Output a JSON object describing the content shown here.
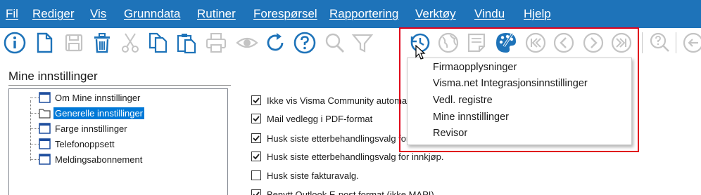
{
  "menubar": {
    "items": [
      {
        "label": "Fil"
      },
      {
        "label": "Rediger"
      },
      {
        "label": "Vis"
      },
      {
        "label": "Grunndata"
      },
      {
        "label": "Rutiner"
      },
      {
        "label": "Forespørsel"
      },
      {
        "label": "Rapportering"
      },
      {
        "label": "Verktøy"
      },
      {
        "label": "Vindu"
      },
      {
        "label": "Hjelp"
      }
    ],
    "color": "#1e73b9"
  },
  "toolbar": {
    "icons": [
      "info-icon",
      "new-document-icon",
      "save-icon",
      "delete-icon",
      "cut-icon",
      "copy-icon",
      "paste-icon",
      "print-icon",
      "preview-icon",
      "refresh-icon",
      "help-icon",
      "search-icon",
      "filter-icon",
      "history-icon",
      "globe-icon",
      "note-icon",
      "palette-icon",
      "first-record-icon",
      "previous-record-icon",
      "next-record-icon",
      "last-record-icon",
      "context-help-icon",
      "back-icon"
    ],
    "accent_color": "#1e73b9"
  },
  "panel": {
    "title": "Mine innstillinger",
    "tree": [
      {
        "label": "Om Mine innstillinger",
        "icon": "page-icon",
        "selected": false
      },
      {
        "label": "Generelle innstillinger",
        "icon": "folder-icon",
        "selected": true
      },
      {
        "label": "Farge innstillinger",
        "icon": "page-icon",
        "selected": false
      },
      {
        "label": "Telefonoppsett",
        "icon": "page-icon",
        "selected": false
      },
      {
        "label": "Meldingsabonnement",
        "icon": "page-icon",
        "selected": false
      }
    ]
  },
  "settings": {
    "checkboxes": [
      {
        "label": "Ikke vis Visma Community automat",
        "checked": true
      },
      {
        "label": "Mail vedlegg i PDF-format",
        "checked": true
      },
      {
        "label": "Husk siste etterbehandlingsvalg for",
        "checked": true
      },
      {
        "label": "Husk siste etterbehandlingsvalg for innkjøp.",
        "checked": true
      },
      {
        "label": "Husk siste fakturavalg.",
        "checked": false
      },
      {
        "label": "Benytt Outlook E-post format (ikke MAPI)",
        "checked": true
      }
    ]
  },
  "dropdown": {
    "items": [
      {
        "label": "Firmaopplysninger"
      },
      {
        "label": "Visma.net Integrasjonsinnstillinger"
      },
      {
        "label": "Vedl. registre"
      },
      {
        "label": "Mine innstillinger"
      },
      {
        "label": "Revisor"
      }
    ],
    "highlight_color": "#e0001b"
  }
}
